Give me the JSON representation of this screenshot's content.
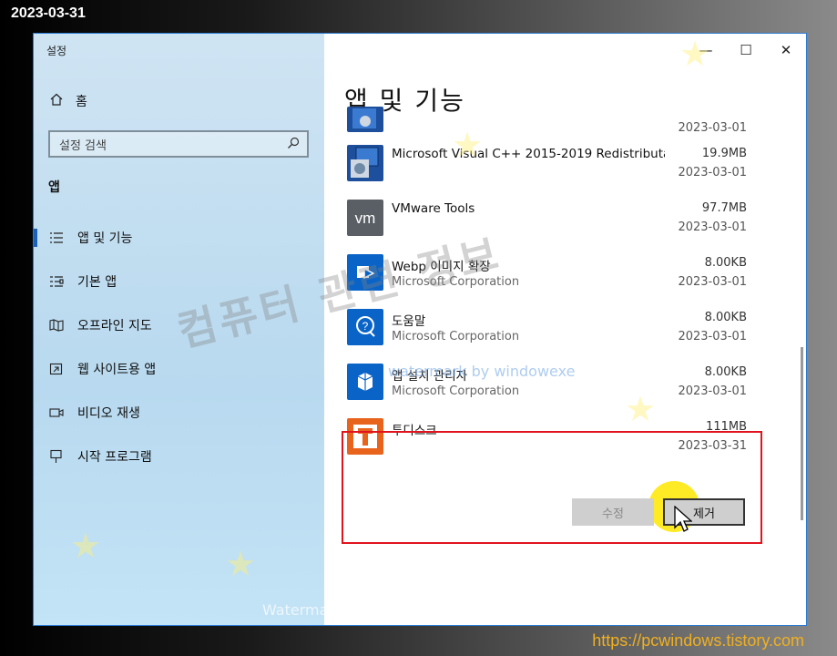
{
  "stamp": {
    "date": "2023-03-31",
    "url": "https://pcwindows.tistory.com"
  },
  "window": {
    "title": "설정",
    "controls": {
      "minimize": "—",
      "maximize": "☐",
      "close": "✕"
    }
  },
  "sidebar": {
    "home_label": "홈",
    "search_placeholder": "설정 검색",
    "section_label": "앱",
    "items": [
      {
        "label": "앱 및 기능",
        "icon": "list-icon",
        "active": true
      },
      {
        "label": "기본 앱",
        "icon": "default-apps-icon",
        "active": false
      },
      {
        "label": "오프라인 지도",
        "icon": "map-icon",
        "active": false
      },
      {
        "label": "웹 사이트용 앱",
        "icon": "web-app-icon",
        "active": false
      },
      {
        "label": "비디오 재생",
        "icon": "video-icon",
        "active": false
      },
      {
        "label": "시작 프로그램",
        "icon": "startup-icon",
        "active": false
      }
    ]
  },
  "main": {
    "title": "앱 및 기능",
    "apps": [
      {
        "name": "",
        "publisher": "",
        "size": "",
        "date": "2023-03-01",
        "icon": "installer-icon"
      },
      {
        "name": "Microsoft Visual C++ 2015-2019 Redistributa...",
        "publisher": "",
        "size": "19.9MB",
        "date": "2023-03-01",
        "icon": "installer-icon"
      },
      {
        "name": "VMware Tools",
        "publisher": "",
        "size": "97.7MB",
        "date": "2023-03-01",
        "icon": "vmware-icon"
      },
      {
        "name": "Webp 이미지 확장",
        "publisher": "Microsoft Corporation",
        "size": "8.00KB",
        "date": "2023-03-01",
        "icon": "webp-icon"
      },
      {
        "name": "도움말",
        "publisher": "Microsoft Corporation",
        "size": "8.00KB",
        "date": "2023-03-01",
        "icon": "help-icon"
      },
      {
        "name": "앱 설치 관리자",
        "publisher": "Microsoft Corporation",
        "size": "8.00KB",
        "date": "2023-03-01",
        "icon": "app-installer-icon"
      },
      {
        "name": "투디스크",
        "publisher": "",
        "size": "111MB",
        "date": "2023-03-31",
        "icon": "todisk-icon"
      }
    ],
    "buttons": {
      "modify": "수정",
      "remove": "제거"
    }
  },
  "watermarks": {
    "korean": "컴퓨터 관련 정보",
    "blue": "watermark by windowexe",
    "bottom": "Watermarked by WindowexeWatermark"
  },
  "colors": {
    "accent": "#1a62b8",
    "selection_border": "#e0141e",
    "todisk_orange": "#e8631c"
  }
}
